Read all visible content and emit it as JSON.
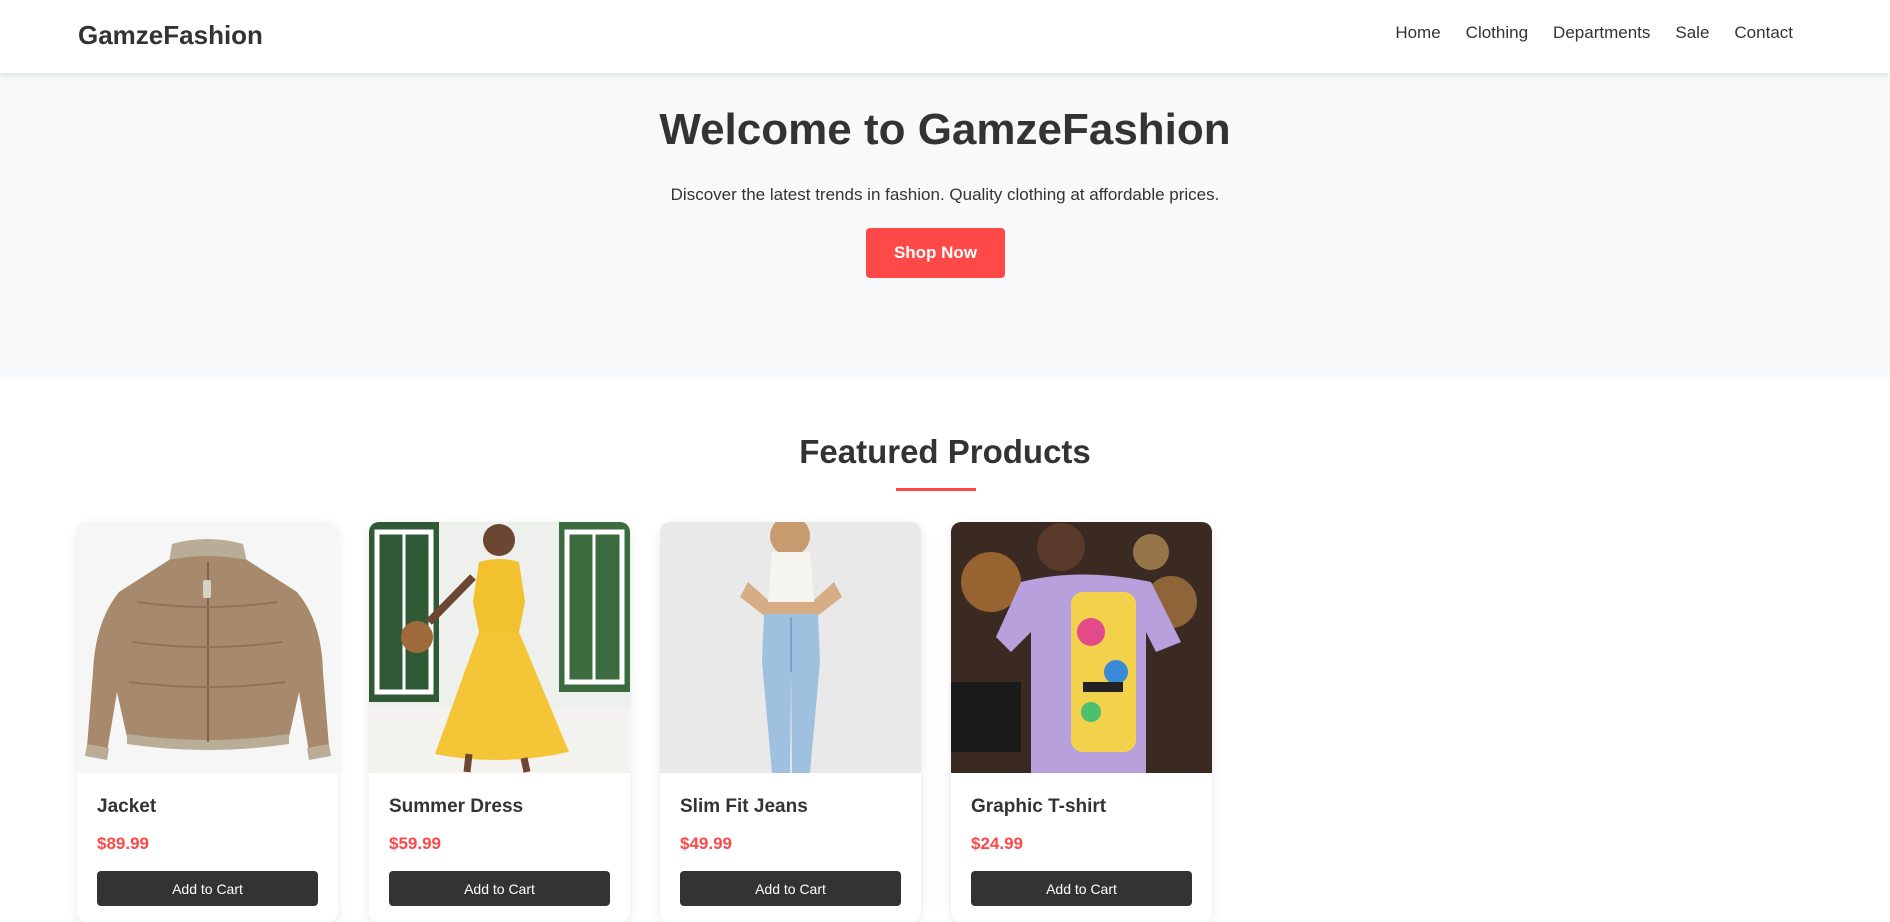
{
  "header": {
    "logo": "GamzeFashion",
    "nav": [
      "Home",
      "Clothing",
      "Departments",
      "Sale",
      "Contact"
    ]
  },
  "hero": {
    "title": "Welcome to GamzeFashion",
    "subtitle": "Discover the latest trends in fashion. Quality clothing at affordable prices.",
    "cta_label": "Shop Now"
  },
  "featured": {
    "title": "Featured Products",
    "products": [
      {
        "name": "Jacket",
        "price": "$89.99",
        "button": "Add to Cart",
        "image": "tan-bomber-jacket"
      },
      {
        "name": "Summer Dress",
        "price": "$59.99",
        "button": "Add to Cart",
        "image": "yellow-polka-dot-dress"
      },
      {
        "name": "Slim Fit Jeans",
        "price": "$49.99",
        "button": "Add to Cart",
        "image": "light-blue-jeans"
      },
      {
        "name": "Graphic T-shirt",
        "price": "$24.99",
        "button": "Add to Cart",
        "image": "purple-graphic-tshirt"
      }
    ]
  },
  "colors": {
    "accent": "#ff4848",
    "dark": "#333333",
    "hero_bg": "#f8f9fa"
  }
}
